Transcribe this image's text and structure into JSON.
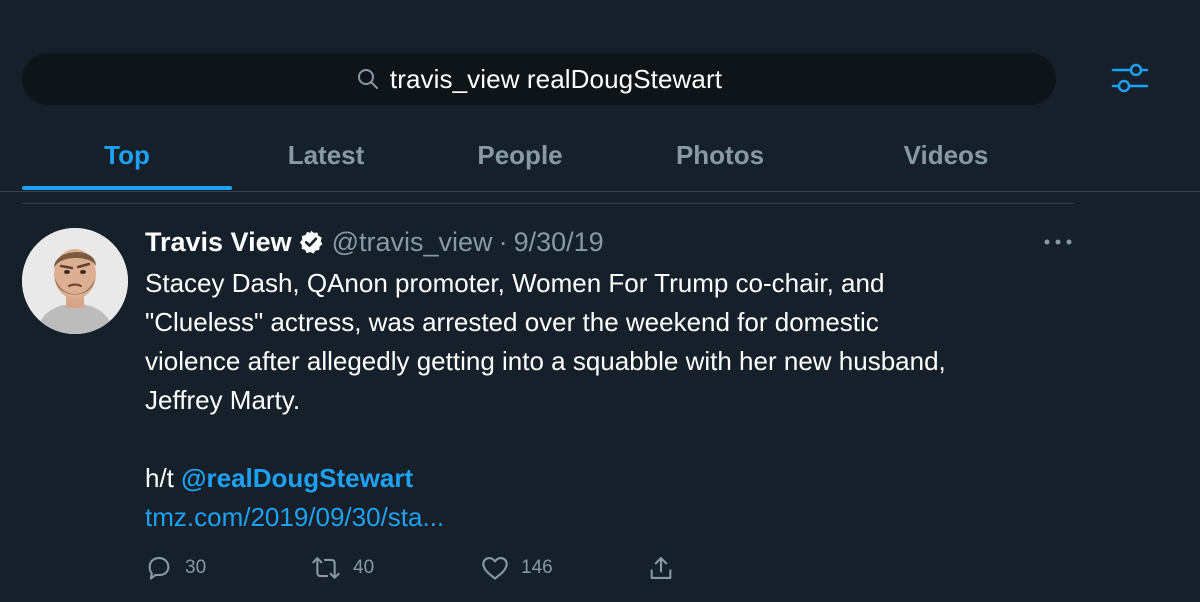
{
  "search": {
    "query": "travis_view realDougStewart"
  },
  "tabs": [
    {
      "label": "Top",
      "active": true
    },
    {
      "label": "Latest",
      "active": false
    },
    {
      "label": "People",
      "active": false
    },
    {
      "label": "Photos",
      "active": false
    },
    {
      "label": "Videos",
      "active": false
    }
  ],
  "tweet": {
    "author_name": "Travis View",
    "verified": true,
    "handle": "@travis_view",
    "separator": "·",
    "date": "9/30/19",
    "lines": [
      "Stacey Dash, QAnon promoter, Women For Trump co-chair, and",
      "\"Clueless\" actress, was arrested over the weekend for domestic",
      "violence after allegedly getting into a squabble with her new husband,",
      "Jeffrey Marty."
    ],
    "hat_prefix": "h/t ",
    "mention": "@realDougStewart",
    "link": "tmz.com/2019/09/30/sta...",
    "actions": {
      "replies": "30",
      "retweets": "40",
      "likes": "146"
    }
  },
  "icons": {
    "search": "search-icon",
    "filter": "sliders-icon",
    "verified": "verified-badge-icon",
    "more": "more-horizontal-icon",
    "reply": "reply-icon",
    "retweet": "retweet-icon",
    "like": "heart-icon",
    "share": "share-icon"
  },
  "colors": {
    "background": "#15202b",
    "accent": "#1da1f2",
    "muted": "#8899a6",
    "search_bg": "#0f1419"
  }
}
